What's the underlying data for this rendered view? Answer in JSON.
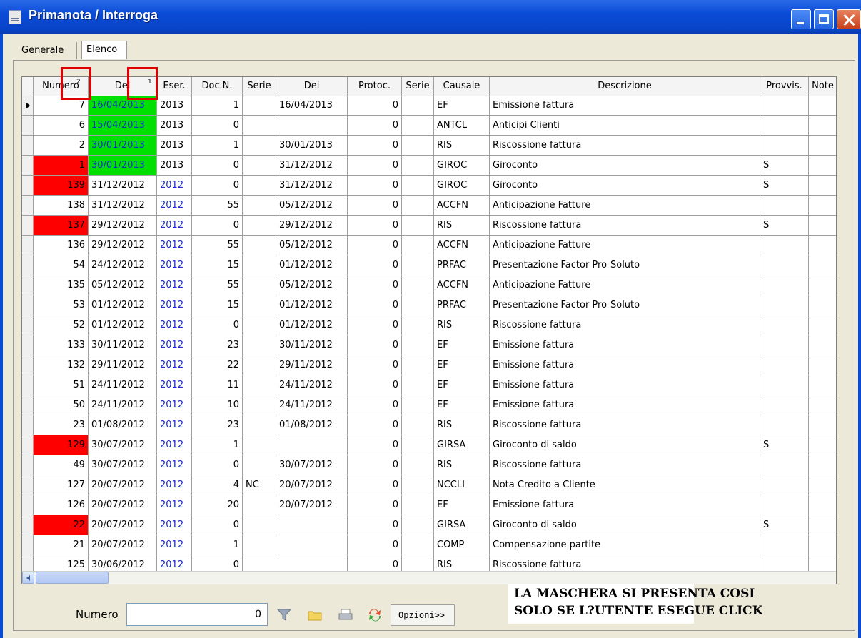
{
  "window": {
    "title": "Primanota / Interroga"
  },
  "tabs": [
    {
      "label": "Generale"
    },
    {
      "label": "Elenco"
    }
  ],
  "grid": {
    "columns": [
      "Numero",
      "Del",
      "Eser.",
      "Doc.N.",
      "Serie",
      "Del",
      "Protoc.",
      "Serie",
      "Causale",
      "Descrizione",
      "Provvis.",
      "Note"
    ],
    "sort_markers": {
      "numero": "2",
      "del": "1"
    },
    "rows": [
      {
        "numero": "7",
        "del": "16/04/2013",
        "eser": "2013",
        "docn": "1",
        "serie": "",
        "del2": "16/04/2013",
        "protoc": "0",
        "serie2": "",
        "causale": "EF",
        "descr": "Emissione fattura",
        "provvis": "",
        "note": "",
        "hl_num": false,
        "hl_del": true,
        "current": true
      },
      {
        "numero": "6",
        "del": "15/04/2013",
        "eser": "2013",
        "docn": "0",
        "serie": "",
        "del2": "",
        "protoc": "0",
        "serie2": "",
        "causale": "ANTCL",
        "descr": "Anticipi Clienti",
        "provvis": "",
        "note": "",
        "hl_num": false,
        "hl_del": true
      },
      {
        "numero": "2",
        "del": "30/01/2013",
        "eser": "2013",
        "docn": "1",
        "serie": "",
        "del2": "30/01/2013",
        "protoc": "0",
        "serie2": "",
        "causale": "RIS",
        "descr": "Riscossione fattura",
        "provvis": "",
        "note": "",
        "hl_num": false,
        "hl_del": true
      },
      {
        "numero": "1",
        "del": "30/01/2013",
        "eser": "2013",
        "docn": "0",
        "serie": "",
        "del2": "31/12/2012",
        "protoc": "0",
        "serie2": "",
        "causale": "GIROC",
        "descr": "Giroconto",
        "provvis": "S",
        "note": "",
        "hl_num": true,
        "hl_del": true
      },
      {
        "numero": "139",
        "del": "31/12/2012",
        "eser": "2012",
        "docn": "0",
        "serie": "",
        "del2": "31/12/2012",
        "protoc": "0",
        "serie2": "",
        "causale": "GIROC",
        "descr": "Giroconto",
        "provvis": "S",
        "note": "",
        "hl_num": true,
        "hl_del": false
      },
      {
        "numero": "138",
        "del": "31/12/2012",
        "eser": "2012",
        "docn": "55",
        "serie": "",
        "del2": "05/12/2012",
        "protoc": "0",
        "serie2": "",
        "causale": "ACCFN",
        "descr": "Anticipazione Fatture",
        "provvis": "",
        "note": "",
        "hl_num": false,
        "hl_del": false
      },
      {
        "numero": "137",
        "del": "29/12/2012",
        "eser": "2012",
        "docn": "0",
        "serie": "",
        "del2": "29/12/2012",
        "protoc": "0",
        "serie2": "",
        "causale": "RIS",
        "descr": "Riscossione fattura",
        "provvis": "S",
        "note": "",
        "hl_num": true,
        "hl_del": false
      },
      {
        "numero": "136",
        "del": "29/12/2012",
        "eser": "2012",
        "docn": "55",
        "serie": "",
        "del2": "05/12/2012",
        "protoc": "0",
        "serie2": "",
        "causale": "ACCFN",
        "descr": "Anticipazione Fatture",
        "provvis": "",
        "note": "",
        "hl_num": false,
        "hl_del": false
      },
      {
        "numero": "54",
        "del": "24/12/2012",
        "eser": "2012",
        "docn": "15",
        "serie": "",
        "del2": "01/12/2012",
        "protoc": "0",
        "serie2": "",
        "causale": "PRFAC",
        "descr": "Presentazione Factor Pro-Soluto",
        "provvis": "",
        "note": "",
        "hl_num": false,
        "hl_del": false
      },
      {
        "numero": "135",
        "del": "05/12/2012",
        "eser": "2012",
        "docn": "55",
        "serie": "",
        "del2": "05/12/2012",
        "protoc": "0",
        "serie2": "",
        "causale": "ACCFN",
        "descr": "Anticipazione Fatture",
        "provvis": "",
        "note": "",
        "hl_num": false,
        "hl_del": false
      },
      {
        "numero": "53",
        "del": "01/12/2012",
        "eser": "2012",
        "docn": "15",
        "serie": "",
        "del2": "01/12/2012",
        "protoc": "0",
        "serie2": "",
        "causale": "PRFAC",
        "descr": "Presentazione Factor Pro-Soluto",
        "provvis": "",
        "note": "",
        "hl_num": false,
        "hl_del": false
      },
      {
        "numero": "52",
        "del": "01/12/2012",
        "eser": "2012",
        "docn": "0",
        "serie": "",
        "del2": "01/12/2012",
        "protoc": "0",
        "serie2": "",
        "causale": "RIS",
        "descr": "Riscossione fattura",
        "provvis": "",
        "note": "",
        "hl_num": false,
        "hl_del": false
      },
      {
        "numero": "133",
        "del": "30/11/2012",
        "eser": "2012",
        "docn": "23",
        "serie": "",
        "del2": "30/11/2012",
        "protoc": "0",
        "serie2": "",
        "causale": "EF",
        "descr": "Emissione fattura",
        "provvis": "",
        "note": "",
        "hl_num": false,
        "hl_del": false
      },
      {
        "numero": "132",
        "del": "29/11/2012",
        "eser": "2012",
        "docn": "22",
        "serie": "",
        "del2": "29/11/2012",
        "protoc": "0",
        "serie2": "",
        "causale": "EF",
        "descr": "Emissione fattura",
        "provvis": "",
        "note": "",
        "hl_num": false,
        "hl_del": false
      },
      {
        "numero": "51",
        "del": "24/11/2012",
        "eser": "2012",
        "docn": "11",
        "serie": "",
        "del2": "24/11/2012",
        "protoc": "0",
        "serie2": "",
        "causale": "EF",
        "descr": "Emissione fattura",
        "provvis": "",
        "note": "",
        "hl_num": false,
        "hl_del": false
      },
      {
        "numero": "50",
        "del": "24/11/2012",
        "eser": "2012",
        "docn": "10",
        "serie": "",
        "del2": "24/11/2012",
        "protoc": "0",
        "serie2": "",
        "causale": "EF",
        "descr": "Emissione fattura",
        "provvis": "",
        "note": "",
        "hl_num": false,
        "hl_del": false
      },
      {
        "numero": "23",
        "del": "01/08/2012",
        "eser": "2012",
        "docn": "23",
        "serie": "",
        "del2": "01/08/2012",
        "protoc": "0",
        "serie2": "",
        "causale": "RIS",
        "descr": "Riscossione fattura",
        "provvis": "",
        "note": "",
        "hl_num": false,
        "hl_del": false
      },
      {
        "numero": "129",
        "del": "30/07/2012",
        "eser": "2012",
        "docn": "1",
        "serie": "",
        "del2": "",
        "protoc": "0",
        "serie2": "",
        "causale": "GIRSA",
        "descr": "Giroconto di saldo",
        "provvis": "S",
        "note": "",
        "hl_num": true,
        "hl_del": false
      },
      {
        "numero": "49",
        "del": "30/07/2012",
        "eser": "2012",
        "docn": "0",
        "serie": "",
        "del2": "30/07/2012",
        "protoc": "0",
        "serie2": "",
        "causale": "RIS",
        "descr": "Riscossione fattura",
        "provvis": "",
        "note": "",
        "hl_num": false,
        "hl_del": false
      },
      {
        "numero": "127",
        "del": "20/07/2012",
        "eser": "2012",
        "docn": "4",
        "serie": "NC",
        "del2": "20/07/2012",
        "protoc": "0",
        "serie2": "",
        "causale": "NCCLI",
        "descr": "Nota Credito a Cliente",
        "provvis": "",
        "note": "",
        "hl_num": false,
        "hl_del": false
      },
      {
        "numero": "126",
        "del": "20/07/2012",
        "eser": "2012",
        "docn": "20",
        "serie": "",
        "del2": "20/07/2012",
        "protoc": "0",
        "serie2": "",
        "causale": "EF",
        "descr": "Emissione fattura",
        "provvis": "",
        "note": "",
        "hl_num": false,
        "hl_del": false
      },
      {
        "numero": "22",
        "del": "20/07/2012",
        "eser": "2012",
        "docn": "0",
        "serie": "",
        "del2": "",
        "protoc": "0",
        "serie2": "",
        "causale": "GIRSA",
        "descr": "Giroconto di saldo",
        "provvis": "S",
        "note": "",
        "hl_num": true,
        "hl_del": false
      },
      {
        "numero": "21",
        "del": "20/07/2012",
        "eser": "2012",
        "docn": "1",
        "serie": "",
        "del2": "",
        "protoc": "0",
        "serie2": "",
        "causale": "COMP",
        "descr": "Compensazione partite",
        "provvis": "",
        "note": "",
        "hl_num": false,
        "hl_del": false
      },
      {
        "numero": "125",
        "del": "30/06/2012",
        "eser": "2012",
        "docn": "0",
        "serie": "",
        "del2": "",
        "protoc": "0",
        "serie2": "",
        "causale": "RIS",
        "descr": "Riscossione fattura",
        "provvis": "",
        "note": "",
        "hl_num": false,
        "hl_del": false
      }
    ]
  },
  "annotation": {
    "line1": "LA MASCHERA SI PRESENTA COSI",
    "line2": "SOLO SE L?UTENTE ESEGUE CLICK"
  },
  "footer": {
    "label": "Numero",
    "value": "0",
    "options_label": "Opzioni>>"
  },
  "colors": {
    "title_bar": "#0a4bd6",
    "highlight_red": "#ff0000",
    "highlight_green": "#00e000",
    "year_blue": "#1a2acc"
  },
  "icons": [
    "filter-icon",
    "folder-icon",
    "printer-icon",
    "refresh-icon"
  ]
}
